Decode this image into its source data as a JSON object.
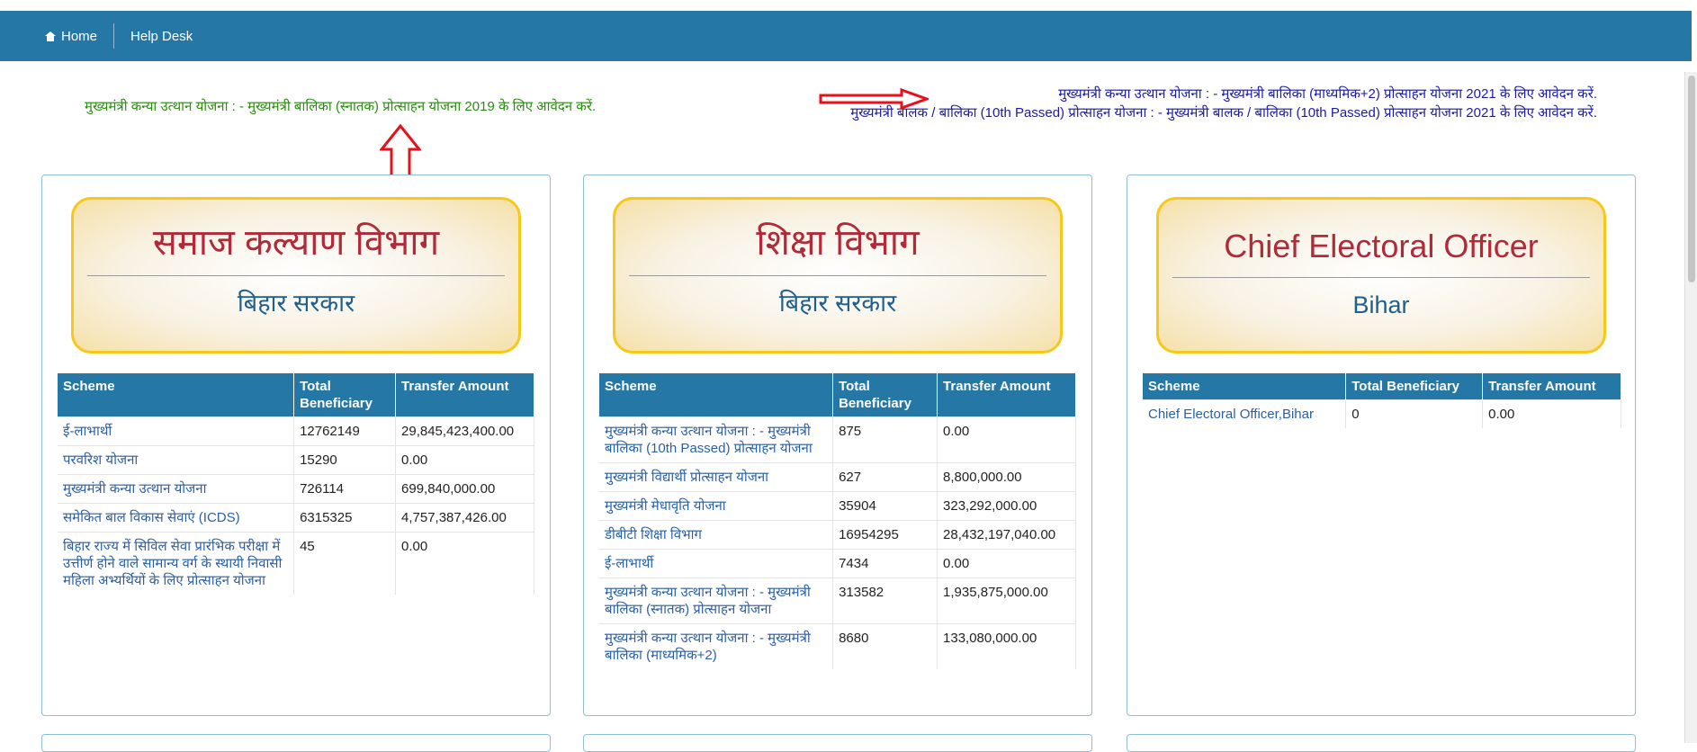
{
  "nav": {
    "home": "Home",
    "helpdesk": "Help Desk"
  },
  "links": {
    "left": "मुख्यमंत्री कन्या उत्थान योजना : - मुख्यमंत्री बालिका (स्नातक) प्रोत्साहन योजना 2019 के लिए आवेदन करें.",
    "right1": "मुख्यमंत्री कन्या उत्थान योजना : - मुख्यमंत्री बालिका (माध्यमिक+2) प्रोत्साहन योजना 2021 के लिए आवेदन करें.",
    "right2": "मुख्यमंत्री बालक / बालिका (10th Passed) प्रोत्साहन योजना : - मुख्यमंत्री बालक / बालिका (10th Passed) प्रोत्साहन योजना 2021 के लिए आवेदन करें."
  },
  "colors": {
    "navbar": "#2578a6",
    "logo_border": "#f5c81a",
    "logo_title": "#b02a3a",
    "logo_sub": "#1f5f8a",
    "link_green": "#2b8a12",
    "link_blue": "#1a1aa8",
    "arrow": "#e8101a"
  },
  "panels": [
    {
      "title": "समाज कल्याण विभाग",
      "subtitle": "बिहार सरकार",
      "headers": {
        "scheme": "Scheme",
        "beneficiary": "Total Beneficiary",
        "amount": "Transfer Amount"
      },
      "rows": [
        {
          "scheme": "ई-लाभार्थी",
          "beneficiary": "12762149",
          "amount": "29,845,423,400.00"
        },
        {
          "scheme": "परवरिश योजना",
          "beneficiary": "15290",
          "amount": "0.00"
        },
        {
          "scheme": "मुख्यमंत्री कन्या उत्थान योजना",
          "beneficiary": "726114",
          "amount": "699,840,000.00"
        },
        {
          "scheme": "समेकित बाल विकास सेवाएं (ICDS)",
          "beneficiary": "6315325",
          "amount": "4,757,387,426.00"
        },
        {
          "scheme": "बिहार राज्य में सिविल सेवा प्रारंभिक परीक्षा में उत्तीर्ण होने वाले सामान्य वर्ग के स्थायी निवासी महिला अभ्यर्थियों के लिए प्रोत्साहन योजना",
          "beneficiary": "45",
          "amount": "0.00"
        }
      ]
    },
    {
      "title": "शिक्षा विभाग",
      "subtitle": "बिहार सरकार",
      "headers": {
        "scheme": "Scheme",
        "beneficiary": "Total Beneficiary",
        "amount": "Transfer Amount"
      },
      "rows": [
        {
          "scheme": "मुख्यमंत्री कन्या उत्थान योजना : - मुख्यमंत्री बालिका (10th Passed) प्रोत्साहन योजना",
          "beneficiary": "875",
          "amount": "0.00"
        },
        {
          "scheme": "मुख्यमंत्री विद्यार्थी प्रोत्साहन योजना",
          "beneficiary": "627",
          "amount": "8,800,000.00"
        },
        {
          "scheme": "मुख्यमंत्री मेधावृति योजना",
          "beneficiary": "35904",
          "amount": "323,292,000.00"
        },
        {
          "scheme": "डीबीटी शिक्षा विभाग",
          "beneficiary": "16954295",
          "amount": "28,432,197,040.00"
        },
        {
          "scheme": "ई-लाभार्थी",
          "beneficiary": "7434",
          "amount": "0.00"
        },
        {
          "scheme": "मुख्यमंत्री कन्या उत्थान योजना : - मुख्यमंत्री बालिका (स्नातक) प्रोत्साहन योजना",
          "beneficiary": "313582",
          "amount": "1,935,875,000.00"
        },
        {
          "scheme": "मुख्यमंत्री कन्या उत्थान योजना : - मुख्यमंत्री बालिका (माध्यमिक+2)",
          "beneficiary": "8680",
          "amount": "133,080,000.00"
        }
      ]
    },
    {
      "title": "Chief Electoral Officer",
      "subtitle": "Bihar",
      "headers": {
        "scheme": "Scheme",
        "beneficiary": "Total Beneficiary",
        "amount": "Transfer Amount"
      },
      "rows": [
        {
          "scheme": "Chief Electoral Officer,Bihar",
          "beneficiary": "0",
          "amount": "0.00"
        }
      ]
    }
  ]
}
